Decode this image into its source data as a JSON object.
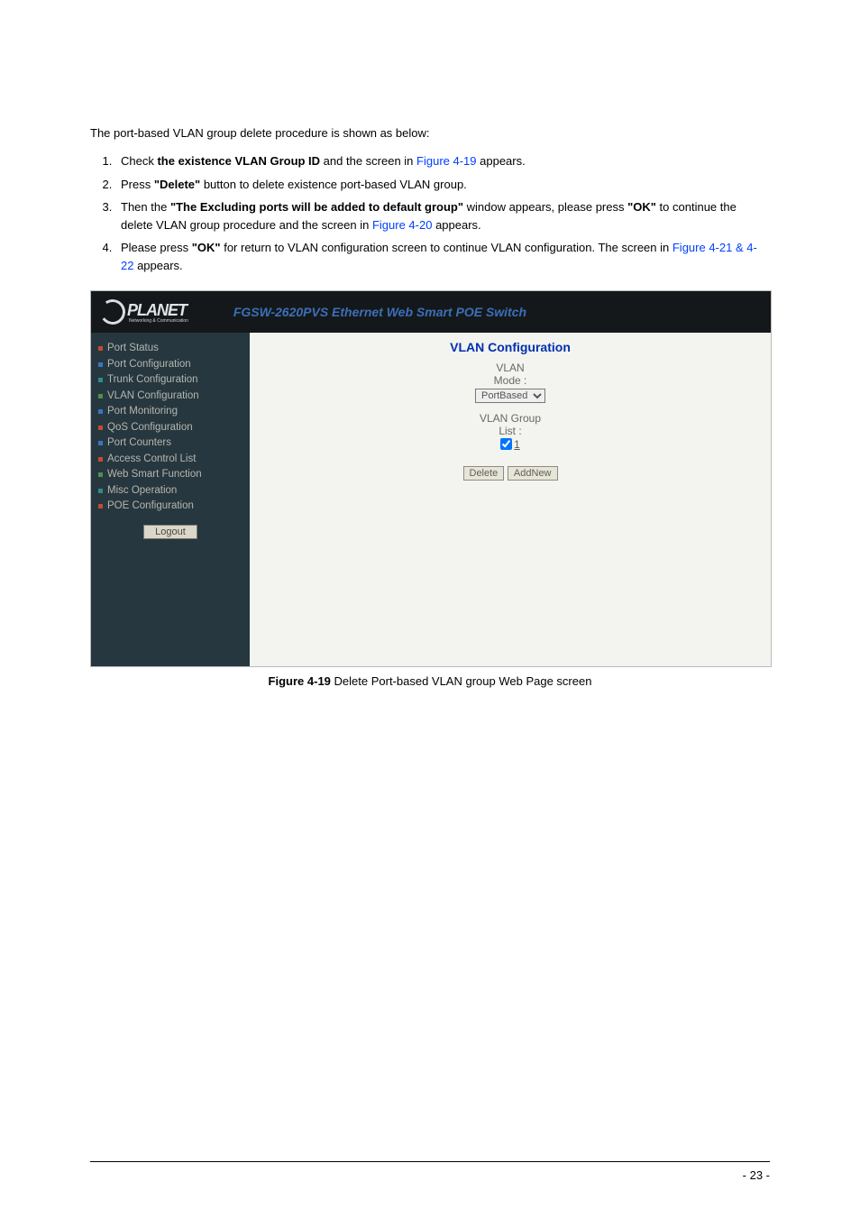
{
  "intro": "The port-based VLAN group delete procedure is shown as below:",
  "steps": {
    "s1_a": "Check ",
    "s1_b": "the existence VLAN Group ID",
    "s1_c": " and the screen in ",
    "s1_link": "Figure 4-19",
    "s1_d": " appears.",
    "s2_a": "Press ",
    "s2_b": "\"Delete\"",
    "s2_c": " button to delete existence port-based VLAN group.",
    "s3_a": "Then the ",
    "s3_b": "\"The Excluding ports will be added to default group\"",
    "s3_c": " window appears, please press ",
    "s3_d": "\"OK\"",
    "s3_e": " to continue the delete VLAN group procedure and the screen in ",
    "s3_link": "Figure 4-20",
    "s3_f": " appears.",
    "s4_a": "Please press ",
    "s4_b": "\"OK\"",
    "s4_c": " for return to VLAN configuration screen to continue VLAN configuration. The screen in ",
    "s4_link": "Figure 4-21 & 4-22",
    "s4_d": " appears."
  },
  "logo_brand": "PLANET",
  "logo_tagline": "Networking & Communication",
  "header_title": "FGSW-2620PVS Ethernet Web Smart POE Switch",
  "sidebar": {
    "items": [
      {
        "label": "Port Status",
        "color": "b-red"
      },
      {
        "label": "Port Configuration",
        "color": "b-blue"
      },
      {
        "label": "Trunk Configuration",
        "color": "b-teal"
      },
      {
        "label": "VLAN Configuration",
        "color": "b-green"
      },
      {
        "label": "Port Monitoring",
        "color": "b-blue"
      },
      {
        "label": "QoS Configuration",
        "color": "b-red"
      },
      {
        "label": "Port Counters",
        "color": "b-blue"
      },
      {
        "label": "Access Control List",
        "color": "b-red"
      },
      {
        "label": "Web Smart Function",
        "color": "b-green"
      },
      {
        "label": "Misc Operation",
        "color": "b-teal"
      },
      {
        "label": "POE Configuration",
        "color": "b-red"
      }
    ],
    "logout": "Logout"
  },
  "panel": {
    "title": "VLAN Configuration",
    "mode_label1": "VLAN",
    "mode_label2": "Mode :",
    "mode_value": "PortBased",
    "group_label1": "VLAN Group",
    "group_label2": "List :",
    "group_item": "1",
    "btn_delete": "Delete",
    "btn_addnew": "AddNew"
  },
  "caption_a": "Figure 4-19",
  "caption_b": " Delete Port-based VLAN group Web Page screen",
  "pagenum": "- 23 -"
}
